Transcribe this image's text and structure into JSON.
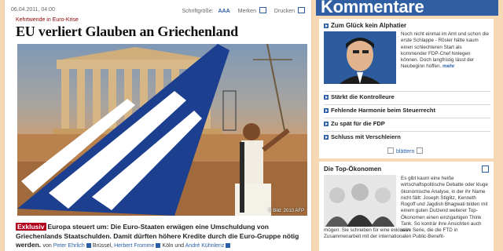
{
  "article": {
    "date": "06.04.2011, 04:00",
    "font_size_label": "Schriftgröße:",
    "font_size_a": "AAA",
    "merken": "Merken",
    "drucken": "Drucken",
    "dachzeile": "Kehrtwende in Euro-Krise",
    "headline": "EU verliert Glauben an Griechenland",
    "photo_credit": "© Bild: 2010 AFP",
    "badge": "Exklusiv",
    "lead": "Europa steuert um: Die Euro-Staaten erwägen eine Umschuldung von Griechenlands Staatschulden. Damit dürften höhere Kredite durch die Euro-Gruppe nötig werden.",
    "byline_von": "von",
    "authors": [
      {
        "name": "Peter Ehrlich",
        "city": "Brüssel,"
      },
      {
        "name": "Herbert Fromme",
        "city": "Köln"
      },
      {
        "name": "André Kühnlenz",
        "city": ""
      }
    ],
    "byline_und": "und"
  },
  "kommentare": {
    "header": "Kommentare",
    "featured_title": "Zum Glück kein Alphatier",
    "featured_text": "Noch nicht einmal im Amt und schon die erste Schlappe - Rösler hätte kaum einen schlechteren Start als kommender FDP-Chef hinlegen können. Doch langfristig lässt der Neubeginn hoffen.",
    "mehr": "mehr",
    "items": [
      "Stärkt die Kontrolleure",
      "Fehlende Harmonie beim Steuerrecht",
      "Zu spät für die FDP",
      "Schluss mit Verschleiern"
    ],
    "blaettern": "blättern"
  },
  "oekonomen": {
    "title": "Die Top-Ökonomen",
    "text_right": "Es gibt kaum eine heiße wirtschaftspolitische Debatte oder kluge ökonomische Analyse, in der ihr Name nicht fällt: Joseph Stiglitz, Kenneth Rogoff und Jagdish Bhagwati bilden mit einem guten Dutzend weiterer Top-Ökonomen einen einzigartigen Think Tank. So konträr ihre Ansichten auch sein",
    "text_full": "mögen: Sie schreiben für eine exklusive Serie, die die FTD in Zusammenarbeit mit der internationalen Public-Benefit-"
  }
}
